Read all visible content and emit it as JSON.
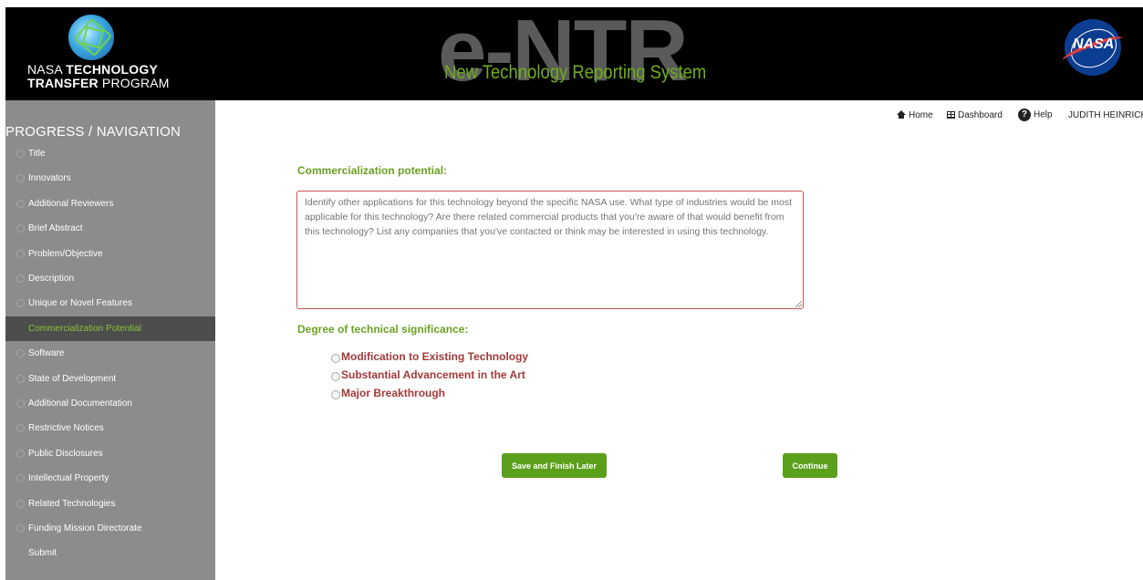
{
  "header": {
    "ntt_line1_normal": "NASA ",
    "ntt_line1_bold": "TECHNOLOGY",
    "ntt_line2_bold": "TRANSFER",
    "ntt_line2_normal": " PROGRAM",
    "entr_logo": "e-NTR",
    "entr_subtitle": "New Technology Reporting System",
    "nasa_logo_text": "NASA"
  },
  "topnav": {
    "home": "Home",
    "dashboard": "Dashboard",
    "help": "Help",
    "user": "JUDITH HEINRICH"
  },
  "sidebar": {
    "title": "PROGRESS / NAVIGATION",
    "items": [
      {
        "label": "Title"
      },
      {
        "label": "Innovators"
      },
      {
        "label": "Additional Reviewers"
      },
      {
        "label": "Brief Abstract"
      },
      {
        "label": "Problem/Objective"
      },
      {
        "label": "Description"
      },
      {
        "label": "Unique or Novel Features"
      },
      {
        "label": "Commercialization Potential"
      },
      {
        "label": "Software"
      },
      {
        "label": "State of Development"
      },
      {
        "label": "Additional Documentation"
      },
      {
        "label": "Restrictive Notices"
      },
      {
        "label": "Public Disclosures"
      },
      {
        "label": "Intellectual Property"
      },
      {
        "label": "Related Technologies"
      },
      {
        "label": "Funding Mission Directorate"
      },
      {
        "label": "Submit"
      }
    ],
    "active_index": 7
  },
  "form": {
    "commercialization_label": "Commercialization potential:",
    "commercialization_placeholder": "Identify other applications for this technology beyond the specific NASA use. What type of industries would be most applicable for this technology? Are there related commercial products that you're aware of that would benefit from this technology? List any companies that you've contacted or think may be interested in using this technology.",
    "commercialization_value": "",
    "significance_label": "Degree of technical significance:",
    "significance_options": [
      "Modification to Existing Technology",
      "Substantial Advancement in the Art",
      "Major Breakthrough"
    ],
    "save_label": "Save and Finish Later",
    "continue_label": "Continue"
  },
  "colors": {
    "accent_green": "#5ba01b",
    "label_green": "#6aa121",
    "option_red": "#a33a3a",
    "sidebar_bg": "#8c8c8c",
    "sidebar_active_bg": "#4d4d4d"
  }
}
